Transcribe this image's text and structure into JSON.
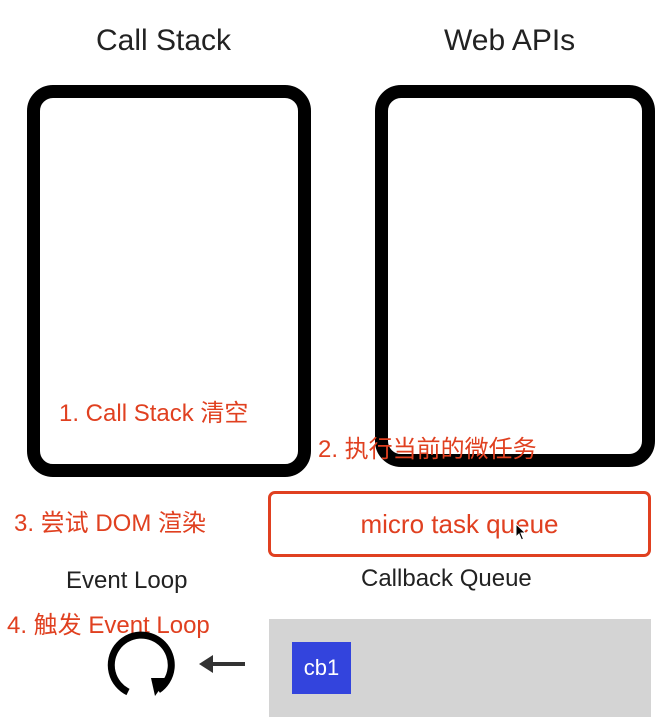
{
  "titles": {
    "call_stack": "Call Stack",
    "web_apis": "Web APIs"
  },
  "steps": {
    "step1": "1. Call Stack 清空",
    "step2": "2. 执行当前的微任务",
    "step3": "3. 尝试 DOM 渲染",
    "step4": "4. 触发 Event Loop"
  },
  "micro_task_queue": {
    "label": "micro task queue"
  },
  "event_loop": {
    "label": "Event Loop",
    "icon": "loop-arrow-icon"
  },
  "callback_queue": {
    "label": "Callback Queue",
    "items": [
      "cb1"
    ]
  },
  "colors": {
    "accent": "#e04020",
    "cb_item": "#3344dd",
    "queue_bg": "#d4d4d4",
    "box_border": "#000000"
  }
}
